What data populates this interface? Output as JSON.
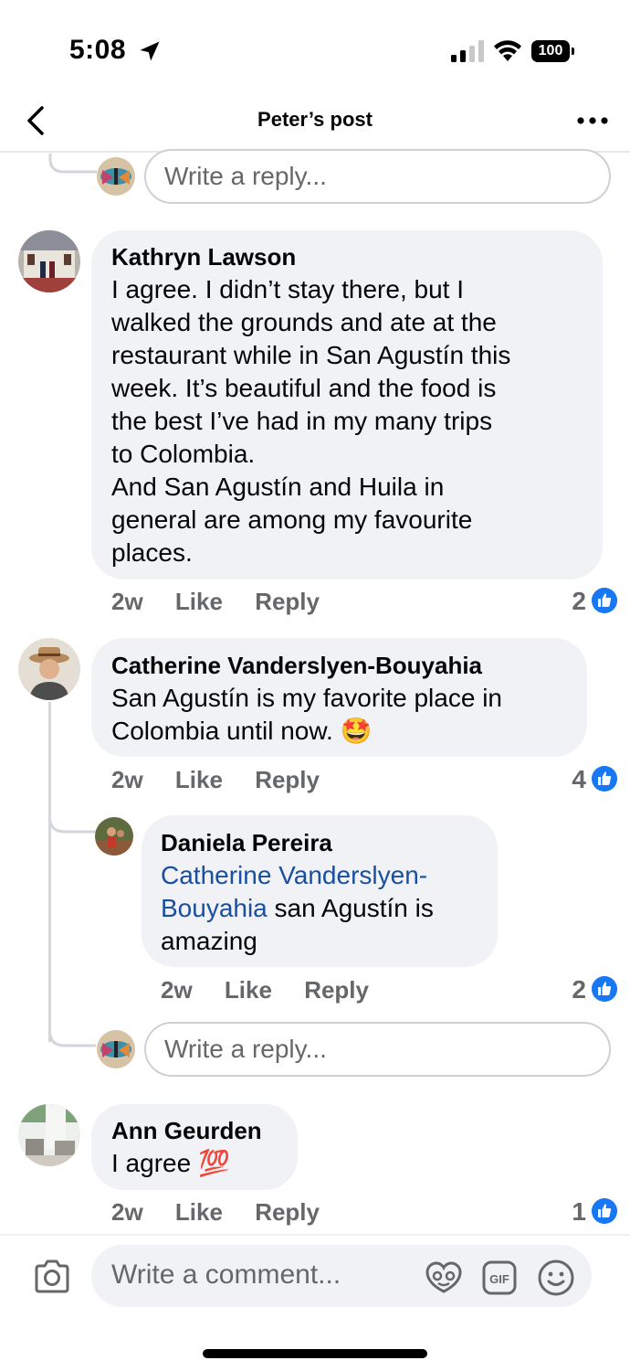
{
  "status_bar": {
    "time": "5:08",
    "battery": "100"
  },
  "header": {
    "title": "Peter’s post"
  },
  "reply_placeholder": "Write a reply...",
  "comments": [
    {
      "author": "Kathryn Lawson",
      "lines": [
        "I agree. I didn’t stay there, but I",
        "walked the grounds and ate at the",
        "restaurant while in San Agustín this",
        "week. It’s beautiful and the food is",
        "the best I’ve had in my many trips",
        "to Colombia.",
        "And San Agustín and Huila in",
        "general are among my favourite",
        "places."
      ],
      "time": "2w",
      "like": "Like",
      "reply": "Reply",
      "reactions": "2"
    },
    {
      "author": "Catherine Vanderslyen-Bouyahia",
      "lines": [
        "San Agustín is my favorite place in",
        "Colombia until now."
      ],
      "emoji": "🤩",
      "time": "2w",
      "like": "Like",
      "reply": "Reply",
      "reactions": "4"
    },
    {
      "author": "Daniela Pereira",
      "mention_line1": "Catherine Vanderslyen-",
      "mention_line2": "Bouyahia",
      "rest_line2": " san Agustín is",
      "line3": "amazing",
      "time": "2w",
      "like": "Like",
      "reply": "Reply",
      "reactions": "2"
    },
    {
      "author": "Ann Geurden",
      "text": "I agree",
      "emoji": "💯",
      "time": "2w",
      "like": "Like",
      "reply": "Reply",
      "reactions": "1"
    }
  ],
  "composer": {
    "placeholder": "Write a comment..."
  },
  "icons": {
    "back": "chevron-left-icon",
    "more": "more-dots-icon",
    "camera": "camera-icon",
    "avatar_sticker": "avatar-sticker-icon",
    "gif": "gif-icon",
    "emoji": "emoji-icon",
    "like_badge": "like-thumb-icon"
  },
  "colors": {
    "accent": "#1877f2",
    "mention": "#1a4fa0",
    "bubble": "#f0f2f5"
  }
}
